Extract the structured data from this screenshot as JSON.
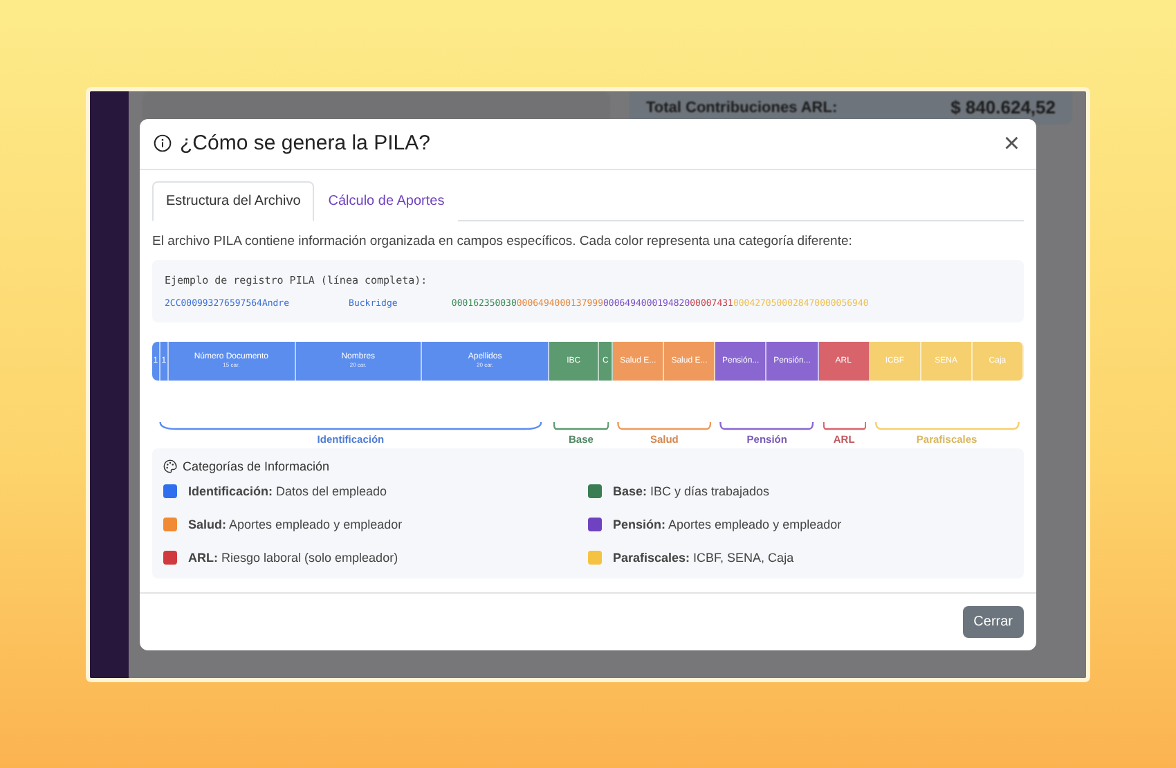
{
  "background_app": {
    "summary_label": "Total Contribuciones ARL:",
    "summary_value": "$ 840.624,52"
  },
  "modal": {
    "title": "¿Cómo se genera la PILA?",
    "close": "×",
    "tabs": [
      {
        "label": "Estructura del Archivo",
        "selected": true
      },
      {
        "label": "Cálculo de Aportes",
        "selected": false
      }
    ],
    "intro": "El archivo PILA contiene información organizada en campos específicos. Cada color representa una categoría diferente:",
    "example": {
      "title": "Ejemplo de registro PILA (línea completa):",
      "parts": [
        {
          "text": "2CC000993276597564Andre           Buckridge          ",
          "color": "#3d6fd6"
        },
        {
          "text": "000162350030",
          "color": "#3b8a55"
        },
        {
          "text": "0006494000137999",
          "color": "#e5883e"
        },
        {
          "text": "0006494000194820",
          "color": "#7b4fc4"
        },
        {
          "text": "00007431",
          "color": "#c9434c"
        },
        {
          "text": "0004270500028470000056940",
          "color": "#efc052"
        }
      ]
    },
    "groups": [
      {
        "label": "Identificación",
        "color": "#5b8def",
        "segments": [
          {
            "label": "1",
            "kind": "narrow"
          },
          {
            "label": "1",
            "kind": "narrow"
          },
          {
            "label": "Número Documento",
            "sub": "15 car.",
            "kind": "wide"
          },
          {
            "label": "Nombres",
            "sub": "20 car.",
            "kind": "wide"
          },
          {
            "label": "Apellidos",
            "sub": "20 car.",
            "kind": "wide"
          }
        ]
      },
      {
        "label": "Base",
        "color": "#5c9a70",
        "segments": [
          {
            "label": "IBC",
            "kind": "normal"
          },
          {
            "label": "C",
            "kind": "small"
          }
        ]
      },
      {
        "label": "Salud",
        "color": "#ef9a5c",
        "segments": [
          {
            "label": "Salud E...",
            "kind": "normal"
          },
          {
            "label": "Salud E...",
            "kind": "normal"
          }
        ]
      },
      {
        "label": "Pensión",
        "color": "#8966d0",
        "segments": [
          {
            "label": "Pensión...",
            "kind": "normal"
          },
          {
            "label": "Pensión...",
            "kind": "normal"
          }
        ]
      },
      {
        "label": "ARL",
        "color": "#d8636b",
        "segments": [
          {
            "label": "ARL",
            "kind": "normal"
          }
        ]
      },
      {
        "label": "Parafiscales",
        "color": "#f6d06f",
        "segments": [
          {
            "label": "ICBF",
            "kind": "normal"
          },
          {
            "label": "SENA",
            "kind": "normal"
          },
          {
            "label": "Caja",
            "kind": "normal"
          }
        ]
      }
    ],
    "legend": {
      "title": "Categorías de Información",
      "items": [
        {
          "text": "**Identificación:** Datos del empleado",
          "color": "#2f6fed"
        },
        {
          "text": "**Base:** IBC y días trabajados",
          "color": "#3b7d52"
        },
        {
          "text": "**Salud:** Aportes empleado y empleador",
          "color": "#f08a35"
        },
        {
          "text": "**Pensión:** Aportes empleado y empleador",
          "color": "#6f42c1"
        },
        {
          "text": "**ARL:** Riesgo laboral (solo empleador)",
          "color": "#d03a3f"
        },
        {
          "text": "**Parafiscales:** ICBF, SENA, Caja",
          "color": "#f5c342"
        }
      ]
    },
    "footer_button": "Cerrar"
  }
}
